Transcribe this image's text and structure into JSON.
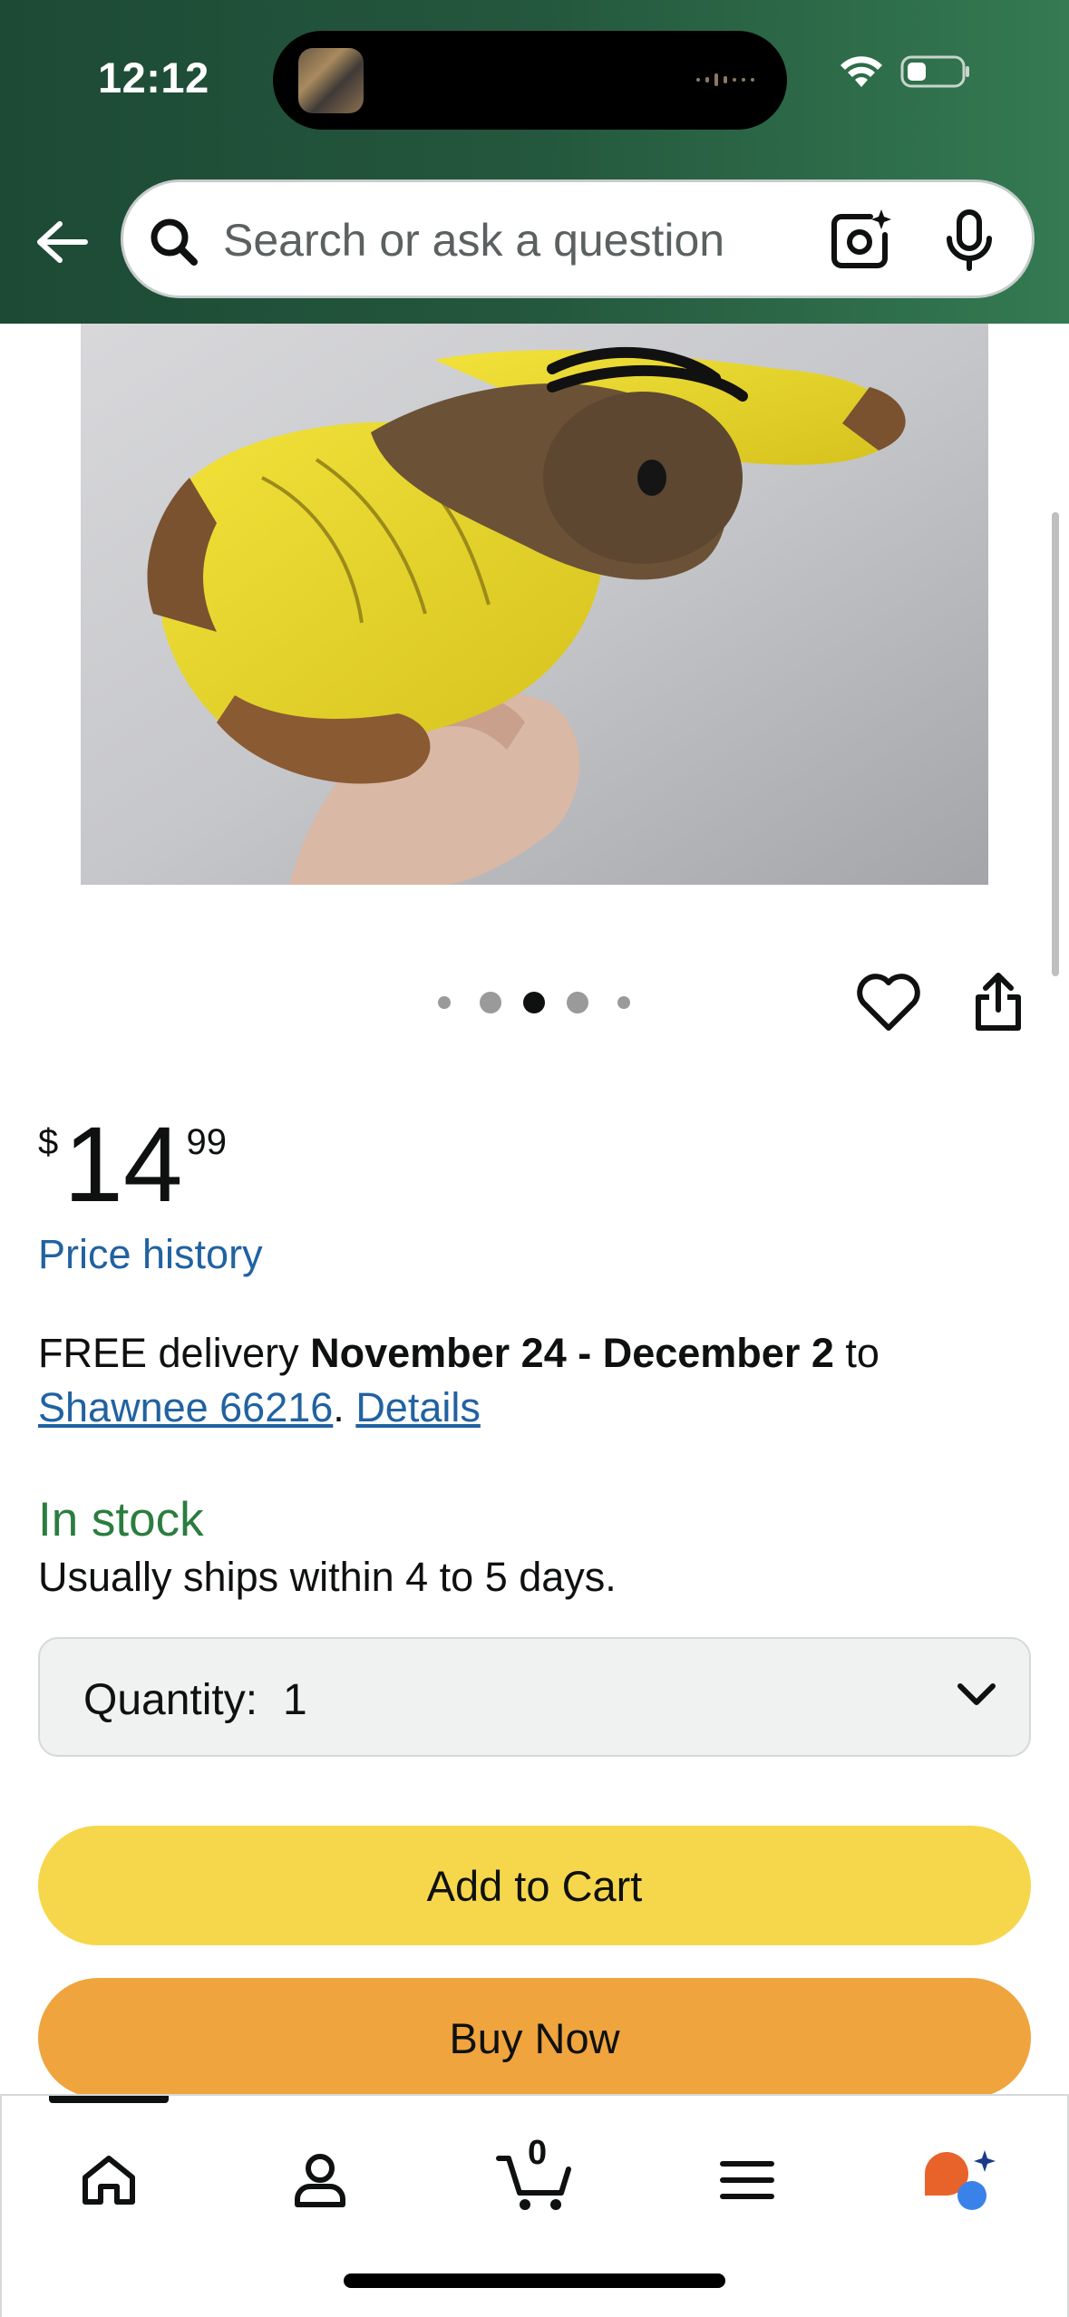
{
  "status_bar": {
    "time": "12:12",
    "icons": [
      "wifi-icon",
      "battery-icon"
    ]
  },
  "header": {
    "back_icon": "arrow-left-icon",
    "search": {
      "placeholder": "Search or ask a question",
      "value": ""
    },
    "camera_icon": "camera-search-icon",
    "mic_icon": "microphone-icon",
    "colors": {
      "gradient_start": "#1d4a35",
      "gradient_end": "#347a52"
    }
  },
  "product": {
    "image_description_icon": "plush-moth-photo",
    "carousel": {
      "total": 5,
      "active_index": 2
    },
    "price": {
      "symbol": "$",
      "whole": "14",
      "fraction": "99"
    },
    "price_history_label": "Price history",
    "delivery": {
      "prefix": "FREE delivery ",
      "dates": "November 24 - December 2",
      "to": " to",
      "location": "Shawnee 66216",
      "separator": ". ",
      "details": "Details"
    },
    "stock": {
      "status": "In stock",
      "ships": "Usually ships within 4 to 5 days.",
      "color": "#2b7d3f"
    },
    "quantity": {
      "label": "Quantity:",
      "value": "1"
    },
    "buttons": {
      "add_to_cart": "Add to Cart",
      "buy_now": "Buy Now",
      "add_to_cart_color": "#f6d74b",
      "buy_now_color": "#efa43e"
    }
  },
  "tabbar": {
    "items": [
      {
        "name": "home",
        "icon": "home-icon"
      },
      {
        "name": "account",
        "icon": "person-icon"
      },
      {
        "name": "cart",
        "icon": "cart-icon",
        "count": "0"
      },
      {
        "name": "menu",
        "icon": "menu-icon"
      },
      {
        "name": "rufus",
        "icon": "rufus-assistant-icon"
      }
    ]
  }
}
